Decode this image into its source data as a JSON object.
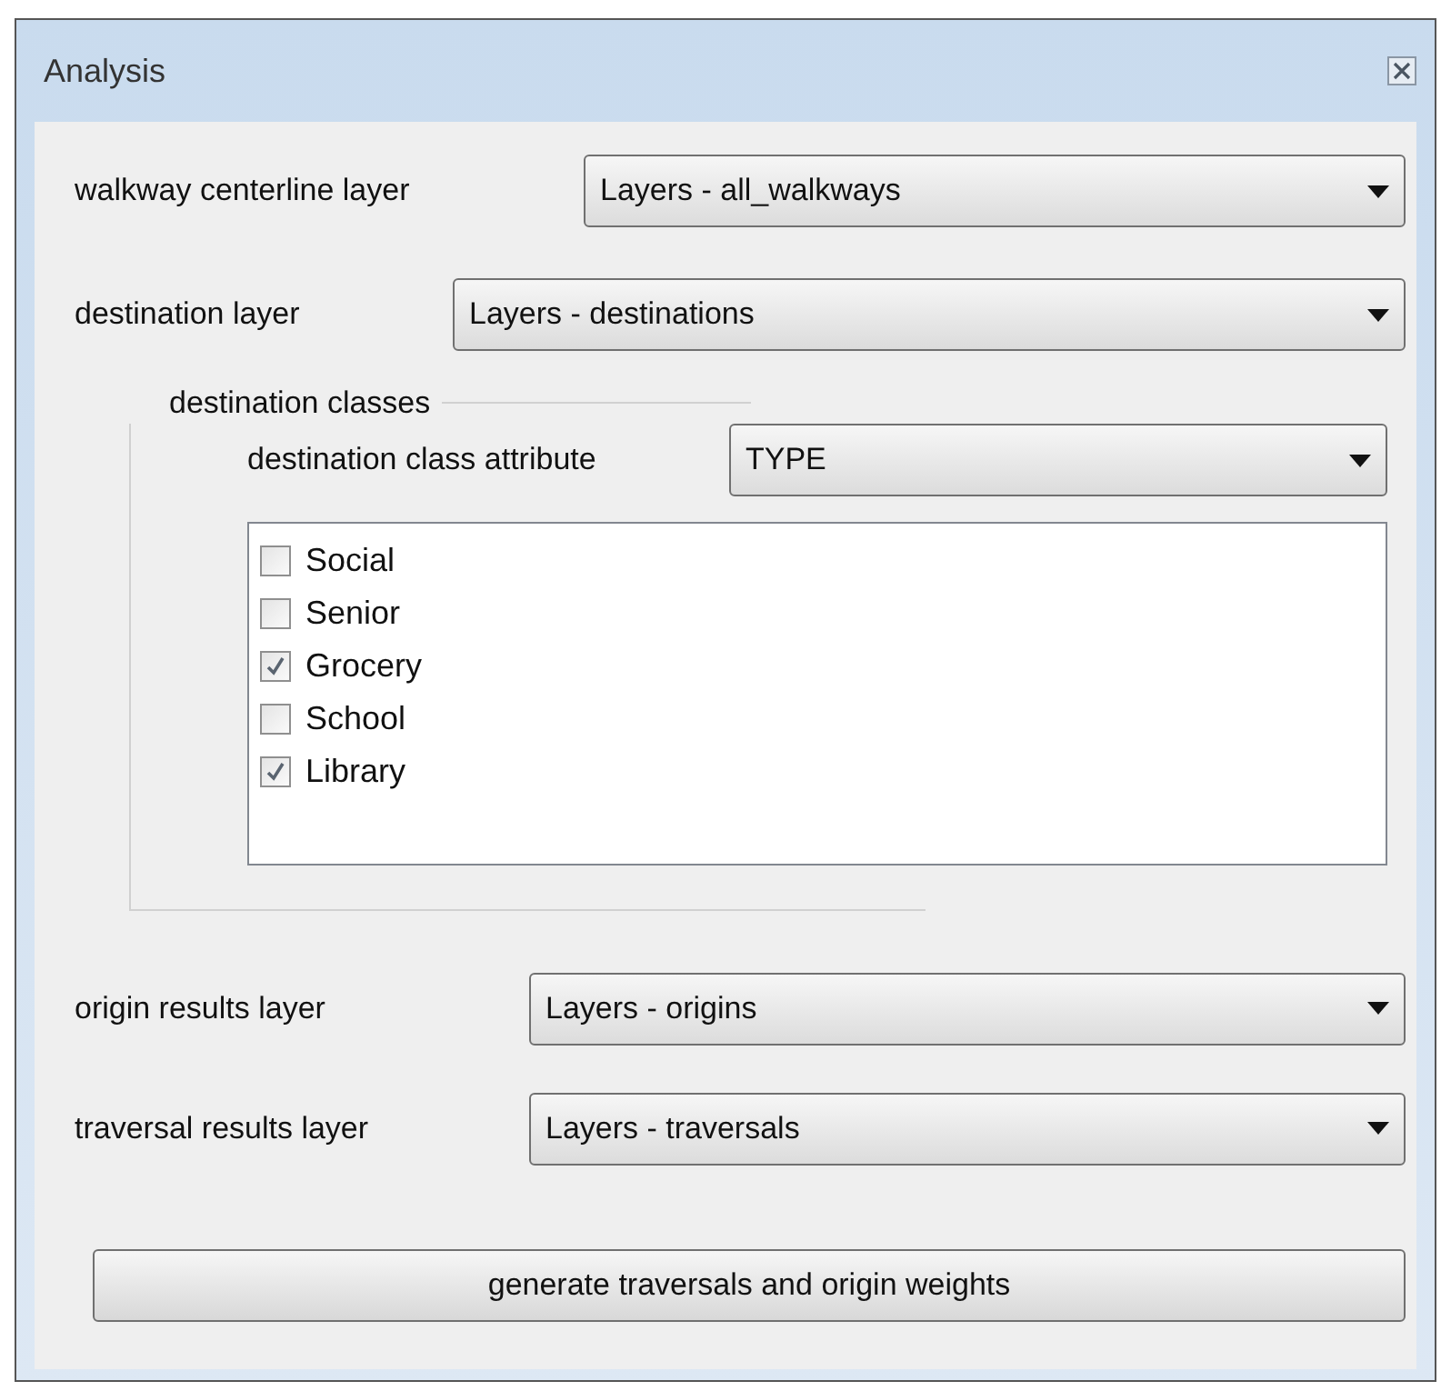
{
  "window": {
    "title": "Analysis"
  },
  "fields": [
    {
      "label": "walkway centerline layer",
      "value": "Layers - all_walkways"
    },
    {
      "label": "destination layer",
      "value": "Layers - destinations"
    }
  ],
  "destination_classes": {
    "title": "destination classes",
    "attribute": {
      "label": "destination class attribute",
      "value": "TYPE"
    },
    "items": [
      {
        "label": "Social",
        "checked": false
      },
      {
        "label": "Senior",
        "checked": false
      },
      {
        "label": "Grocery",
        "checked": true
      },
      {
        "label": "School",
        "checked": false
      },
      {
        "label": "Library",
        "checked": true
      }
    ]
  },
  "result_fields": [
    {
      "label": "origin results layer",
      "value": "Layers - origins"
    },
    {
      "label": "traversal results layer",
      "value": "Layers - traversals"
    }
  ],
  "button": {
    "label": "generate traversals and origin weights"
  }
}
